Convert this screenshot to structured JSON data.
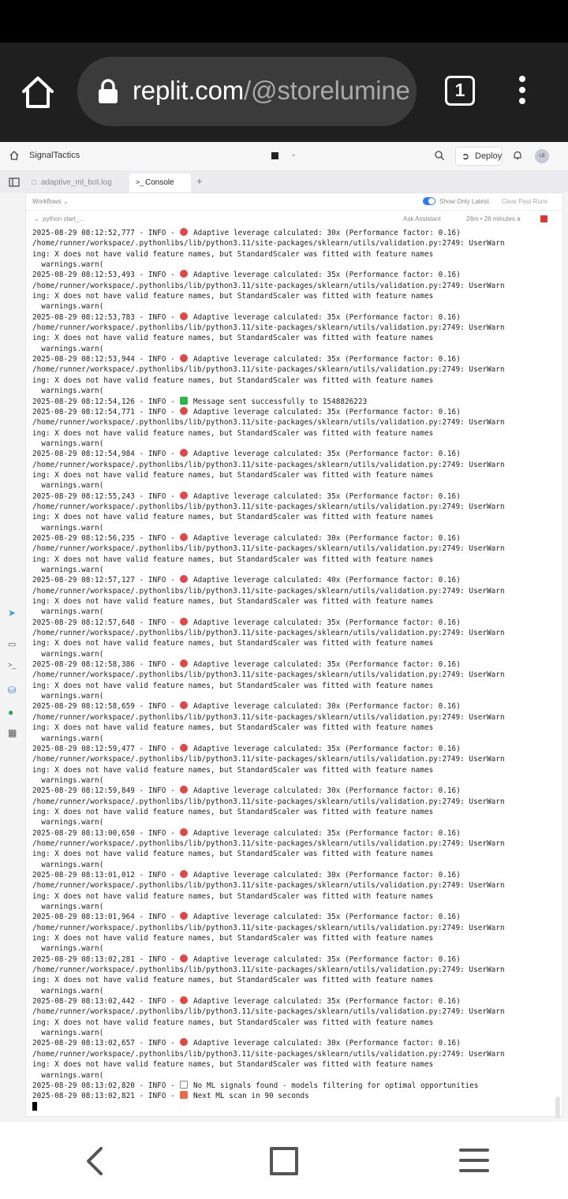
{
  "browser": {
    "url_host": "replit.com",
    "url_path": "/@storelumine",
    "tab_count": "1"
  },
  "app": {
    "project_name": "SignalTactics",
    "deploy_label": "Deploy",
    "avatar_initials": "LB",
    "tabs": [
      {
        "label": "adaptive_ml_bot.log",
        "active": false
      },
      {
        "label": "Console",
        "active": true
      }
    ]
  },
  "workflows": {
    "label": "Workflows",
    "show_only_latest": "Show Only Latest",
    "show_only_latest_on": true,
    "clear_past_runs": "Clear Past Runs",
    "run_name": "python start_...",
    "ask_assistant": "Ask Assistant",
    "run_time": "26m • 26 minutes a"
  },
  "console": {
    "lines": [
      {
        "text": "2025-08-29 08:12:52,777 - INFO - ",
        "emoji": "red",
        "rest": " Adaptive leverage calculated: 30x (Performance factor: 0.16)"
      },
      {
        "text": "/home/runner/workspace/.pythonlibs/lib/python3.11/site-packages/sklearn/utils/validation.py:2749: UserWarn"
      },
      {
        "text": "ing: X does not have valid feature names, but StandardScaler was fitted with feature names"
      },
      {
        "text": "  warnings.warn("
      },
      {
        "text": "2025-08-29 08:12:53,493 - INFO - ",
        "emoji": "red",
        "rest": " Adaptive leverage calculated: 35x (Performance factor: 0.16)"
      },
      {
        "text": "/home/runner/workspace/.pythonlibs/lib/python3.11/site-packages/sklearn/utils/validation.py:2749: UserWarn"
      },
      {
        "text": "ing: X does not have valid feature names, but StandardScaler was fitted with feature names"
      },
      {
        "text": "  warnings.warn("
      },
      {
        "text": "2025-08-29 08:12:53,783 - INFO - ",
        "emoji": "red",
        "rest": " Adaptive leverage calculated: 35x (Performance factor: 0.16)"
      },
      {
        "text": "/home/runner/workspace/.pythonlibs/lib/python3.11/site-packages/sklearn/utils/validation.py:2749: UserWarn"
      },
      {
        "text": "ing: X does not have valid feature names, but StandardScaler was fitted with feature names"
      },
      {
        "text": "  warnings.warn("
      },
      {
        "text": "2025-08-29 08:12:53,944 - INFO - ",
        "emoji": "red",
        "rest": " Adaptive leverage calculated: 35x (Performance factor: 0.16)"
      },
      {
        "text": "/home/runner/workspace/.pythonlibs/lib/python3.11/site-packages/sklearn/utils/validation.py:2749: UserWarn"
      },
      {
        "text": "ing: X does not have valid feature names, but StandardScaler was fitted with feature names"
      },
      {
        "text": "  warnings.warn("
      },
      {
        "text": "2025-08-29 08:12:54,126 - INFO - ",
        "emoji": "green",
        "rest": " Message sent successfully to 1548826223"
      },
      {
        "text": "2025-08-29 08:12:54,771 - INFO - ",
        "emoji": "red",
        "rest": " Adaptive leverage calculated: 35x (Performance factor: 0.16)"
      },
      {
        "text": "/home/runner/workspace/.pythonlibs/lib/python3.11/site-packages/sklearn/utils/validation.py:2749: UserWarn"
      },
      {
        "text": "ing: X does not have valid feature names, but StandardScaler was fitted with feature names"
      },
      {
        "text": "  warnings.warn("
      },
      {
        "text": "2025-08-29 08:12:54,984 - INFO - ",
        "emoji": "red",
        "rest": " Adaptive leverage calculated: 35x (Performance factor: 0.16)"
      },
      {
        "text": "/home/runner/workspace/.pythonlibs/lib/python3.11/site-packages/sklearn/utils/validation.py:2749: UserWarn"
      },
      {
        "text": "ing: X does not have valid feature names, but StandardScaler was fitted with feature names"
      },
      {
        "text": "  warnings.warn("
      },
      {
        "text": "2025-08-29 08:12:55,243 - INFO - ",
        "emoji": "red",
        "rest": " Adaptive leverage calculated: 35x (Performance factor: 0.16)"
      },
      {
        "text": "/home/runner/workspace/.pythonlibs/lib/python3.11/site-packages/sklearn/utils/validation.py:2749: UserWarn"
      },
      {
        "text": "ing: X does not have valid feature names, but StandardScaler was fitted with feature names"
      },
      {
        "text": "  warnings.warn("
      },
      {
        "text": "2025-08-29 08:12:56,235 - INFO - ",
        "emoji": "red",
        "rest": " Adaptive leverage calculated: 30x (Performance factor: 0.16)"
      },
      {
        "text": "/home/runner/workspace/.pythonlibs/lib/python3.11/site-packages/sklearn/utils/validation.py:2749: UserWarn"
      },
      {
        "text": "ing: X does not have valid feature names, but StandardScaler was fitted with feature names"
      },
      {
        "text": "  warnings.warn("
      },
      {
        "text": "2025-08-29 08:12:57,127 - INFO - ",
        "emoji": "red",
        "rest": " Adaptive leverage calculated: 40x (Performance factor: 0.16)"
      },
      {
        "text": "/home/runner/workspace/.pythonlibs/lib/python3.11/site-packages/sklearn/utils/validation.py:2749: UserWarn"
      },
      {
        "text": "ing: X does not have valid feature names, but StandardScaler was fitted with feature names"
      },
      {
        "text": "  warnings.warn("
      },
      {
        "text": "2025-08-29 08:12:57,648 - INFO - ",
        "emoji": "red",
        "rest": " Adaptive leverage calculated: 35x (Performance factor: 0.16)"
      },
      {
        "text": "/home/runner/workspace/.pythonlibs/lib/python3.11/site-packages/sklearn/utils/validation.py:2749: UserWarn"
      },
      {
        "text": "ing: X does not have valid feature names, but StandardScaler was fitted with feature names"
      },
      {
        "text": "  warnings.warn("
      },
      {
        "text": "2025-08-29 08:12:58,386 - INFO - ",
        "emoji": "red",
        "rest": " Adaptive leverage calculated: 35x (Performance factor: 0.16)"
      },
      {
        "text": "/home/runner/workspace/.pythonlibs/lib/python3.11/site-packages/sklearn/utils/validation.py:2749: UserWarn"
      },
      {
        "text": "ing: X does not have valid feature names, but StandardScaler was fitted with feature names"
      },
      {
        "text": "  warnings.warn("
      },
      {
        "text": "2025-08-29 08:12:58,659 - INFO - ",
        "emoji": "red",
        "rest": " Adaptive leverage calculated: 30x (Performance factor: 0.16)"
      },
      {
        "text": "/home/runner/workspace/.pythonlibs/lib/python3.11/site-packages/sklearn/utils/validation.py:2749: UserWarn"
      },
      {
        "text": "ing: X does not have valid feature names, but StandardScaler was fitted with feature names"
      },
      {
        "text": "  warnings.warn("
      },
      {
        "text": "2025-08-29 08:12:59,477 - INFO - ",
        "emoji": "red",
        "rest": " Adaptive leverage calculated: 35x (Performance factor: 0.16)"
      },
      {
        "text": "/home/runner/workspace/.pythonlibs/lib/python3.11/site-packages/sklearn/utils/validation.py:2749: UserWarn"
      },
      {
        "text": "ing: X does not have valid feature names, but StandardScaler was fitted with feature names"
      },
      {
        "text": "  warnings.warn("
      },
      {
        "text": "2025-08-29 08:12:59,849 - INFO - ",
        "emoji": "red",
        "rest": " Adaptive leverage calculated: 30x (Performance factor: 0.16)"
      },
      {
        "text": "/home/runner/workspace/.pythonlibs/lib/python3.11/site-packages/sklearn/utils/validation.py:2749: UserWarn"
      },
      {
        "text": "ing: X does not have valid feature names, but StandardScaler was fitted with feature names"
      },
      {
        "text": "  warnings.warn("
      },
      {
        "text": "2025-08-29 08:13:00,650 - INFO - ",
        "emoji": "red",
        "rest": " Adaptive leverage calculated: 35x (Performance factor: 0.16)"
      },
      {
        "text": "/home/runner/workspace/.pythonlibs/lib/python3.11/site-packages/sklearn/utils/validation.py:2749: UserWarn"
      },
      {
        "text": "ing: X does not have valid feature names, but StandardScaler was fitted with feature names"
      },
      {
        "text": "  warnings.warn("
      },
      {
        "text": "2025-08-29 08:13:01,012 - INFO - ",
        "emoji": "red",
        "rest": " Adaptive leverage calculated: 30x (Performance factor: 0.16)"
      },
      {
        "text": "/home/runner/workspace/.pythonlibs/lib/python3.11/site-packages/sklearn/utils/validation.py:2749: UserWarn"
      },
      {
        "text": "ing: X does not have valid feature names, but StandardScaler was fitted with feature names"
      },
      {
        "text": "  warnings.warn("
      },
      {
        "text": "2025-08-29 08:13:01,964 - INFO - ",
        "emoji": "red",
        "rest": " Adaptive leverage calculated: 35x (Performance factor: 0.16)"
      },
      {
        "text": "/home/runner/workspace/.pythonlibs/lib/python3.11/site-packages/sklearn/utils/validation.py:2749: UserWarn"
      },
      {
        "text": "ing: X does not have valid feature names, but StandardScaler was fitted with feature names"
      },
      {
        "text": "  warnings.warn("
      },
      {
        "text": "2025-08-29 08:13:02,281 - INFO - ",
        "emoji": "red",
        "rest": " Adaptive leverage calculated: 35x (Performance factor: 0.16)"
      },
      {
        "text": "/home/runner/workspace/.pythonlibs/lib/python3.11/site-packages/sklearn/utils/validation.py:2749: UserWarn"
      },
      {
        "text": "ing: X does not have valid feature names, but StandardScaler was fitted with feature names"
      },
      {
        "text": "  warnings.warn("
      },
      {
        "text": "2025-08-29 08:13:02,442 - INFO - ",
        "emoji": "red",
        "rest": " Adaptive leverage calculated: 35x (Performance factor: 0.16)"
      },
      {
        "text": "/home/runner/workspace/.pythonlibs/lib/python3.11/site-packages/sklearn/utils/validation.py:2749: UserWarn"
      },
      {
        "text": "ing: X does not have valid feature names, but StandardScaler was fitted with feature names"
      },
      {
        "text": "  warnings.warn("
      },
      {
        "text": "2025-08-29 08:13:02,657 - INFO - ",
        "emoji": "red",
        "rest": " Adaptive leverage calculated: 30x (Performance factor: 0.16)"
      },
      {
        "text": "/home/runner/workspace/.pythonlibs/lib/python3.11/site-packages/sklearn/utils/validation.py:2749: UserWarn"
      },
      {
        "text": "ing: X does not have valid feature names, but StandardScaler was fitted with feature names"
      },
      {
        "text": "  warnings.warn("
      },
      {
        "text": "2025-08-29 08:13:02,820 - INFO - ",
        "emoji": "chart",
        "rest": " No ML signals found - models filtering for optimal opportunities"
      },
      {
        "text": "2025-08-29 08:13:02,821 - INFO - ",
        "emoji": "clock",
        "rest": " Next ML scan in 90 seconds"
      }
    ]
  }
}
